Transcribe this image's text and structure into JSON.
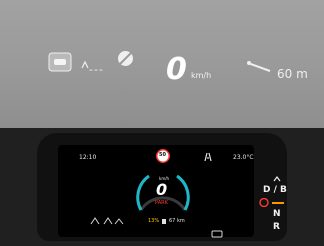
{
  "hud": {
    "nav_dashes": "---",
    "speed_value": "0",
    "speed_unit": "km/h",
    "distance": "60 m"
  },
  "cluster": {
    "time": "12:10",
    "temperature": "23.0°C",
    "speed_limit": "50",
    "speed_unit": "km/h",
    "speed_value": "0",
    "park_label": "PARK",
    "battery_percent": "13%",
    "range": "67 km",
    "gears": [
      "D / B",
      "N",
      "R"
    ]
  },
  "colors": {
    "accent_red": "#ff3b30",
    "accent_orange": "#ff9500",
    "teal": "#1fb6c8"
  }
}
